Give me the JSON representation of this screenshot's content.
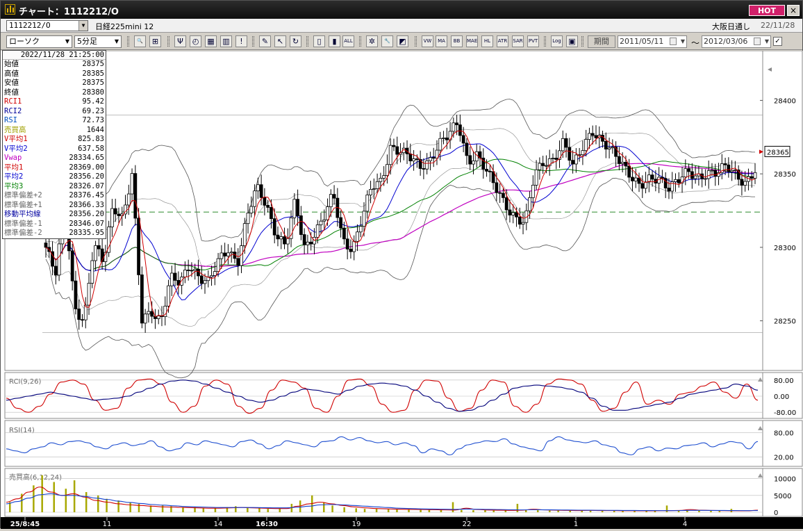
{
  "window": {
    "title": "チャート：1112212/O",
    "hot_label": "HOT",
    "close_label": "×"
  },
  "header": {
    "symbol": "1112212/O",
    "instrument": "日経225mini 12",
    "market": "大阪日通し",
    "date": "22/11/28"
  },
  "toolbar": {
    "chart_type": "ローソク",
    "interval": "5分足",
    "period_label": "期間",
    "from_date": "2011/05/11",
    "tilde": "〜",
    "to_date": "2012/03/06",
    "check_mark": "✓",
    "icons": [
      {
        "name": "zoom-icon",
        "glyph": "🔍"
      },
      {
        "name": "bar-layout-icon",
        "glyph": "⊞"
      },
      {
        "name": "bear-icon",
        "glyph": "Ψ"
      },
      {
        "name": "stopwatch-icon",
        "glyph": "◴"
      },
      {
        "name": "grid-chart-icon",
        "glyph": "▦"
      },
      {
        "name": "multi-bar-icon",
        "glyph": "▥"
      },
      {
        "name": "info-icon",
        "glyph": "!"
      },
      {
        "name": "pencil-icon",
        "glyph": "✎"
      },
      {
        "name": "cursor-icon",
        "glyph": "↖"
      },
      {
        "name": "rotate-icon",
        "glyph": "↻"
      },
      {
        "name": "candle-icon",
        "glyph": "▯"
      },
      {
        "name": "candle-split-icon",
        "glyph": "▮"
      },
      {
        "name": "all-icon",
        "glyph": "ALL"
      },
      {
        "name": "settings-icon",
        "glyph": "✲"
      },
      {
        "name": "wrench-icon",
        "glyph": "🔧"
      },
      {
        "name": "palette-icon",
        "glyph": "◩"
      },
      {
        "name": "vwap-icon",
        "glyph": "VW"
      },
      {
        "name": "ma-icon",
        "glyph": "MA"
      },
      {
        "name": "bb-icon",
        "glyph": "BB"
      },
      {
        "name": "mae-icon",
        "glyph": "MAE"
      },
      {
        "name": "hl-icon",
        "glyph": "HL"
      },
      {
        "name": "atr-icon",
        "glyph": "ATR"
      },
      {
        "name": "sar-icon",
        "glyph": "SAR"
      },
      {
        "name": "pvt-icon",
        "glyph": "PVT"
      },
      {
        "name": "log-icon",
        "glyph": "Log"
      },
      {
        "name": "window-icon",
        "glyph": "▣"
      }
    ]
  },
  "info_panel": {
    "datetime": "2022/11/28  21:25:00",
    "rows": [
      {
        "label": "始値",
        "value": "28375",
        "color": "#000000"
      },
      {
        "label": "高値",
        "value": "28385",
        "color": "#000000"
      },
      {
        "label": "安値",
        "value": "28375",
        "color": "#000000"
      },
      {
        "label": "終値",
        "value": "28380",
        "color": "#000000"
      },
      {
        "label": "RCI1",
        "value": "95.42",
        "color": "#d00000"
      },
      {
        "label": "RCI2",
        "value": "69.23",
        "color": "#000099"
      },
      {
        "label": "RSI",
        "value": "72.73",
        "color": "#0050c0"
      },
      {
        "label": "売買高",
        "value": "1644",
        "color": "#a0a000"
      },
      {
        "label": "V平均1",
        "value": "825.83",
        "color": "#d00000"
      },
      {
        "label": "V平均2",
        "value": "637.58",
        "color": "#0000d0"
      },
      {
        "label": "Vwap",
        "value": "28334.65",
        "color": "#c000c0"
      },
      {
        "label": "平均1",
        "value": "28369.00",
        "color": "#d00000"
      },
      {
        "label": "平均2",
        "value": "28356.20",
        "color": "#0000d0"
      },
      {
        "label": "平均3",
        "value": "28326.07",
        "color": "#008000"
      },
      {
        "label": "標準偏差+2",
        "value": "28376.45",
        "color": "#666666"
      },
      {
        "label": "標準偏差+1",
        "value": "28366.33",
        "color": "#666666"
      },
      {
        "label": "移動平均線",
        "value": "28356.20",
        "color": "#0000a0"
      },
      {
        "label": "標準偏差-1",
        "value": "28346.07",
        "color": "#666666"
      },
      {
        "label": "標準偏差-2",
        "value": "28335.95",
        "color": "#666666"
      }
    ]
  },
  "chart_data": [
    {
      "type": "candlestick",
      "ylim": [
        28220,
        28430
      ],
      "y_ticks": [
        28250,
        28300,
        28350,
        28400
      ],
      "current_price": "28365",
      "dashed_level": 28324,
      "x_labels": [
        "25/8:45",
        "11",
        "14",
        "16:30",
        "19",
        "22",
        "1",
        "4"
      ],
      "path": [
        28300,
        28280,
        28330,
        28260,
        28250,
        28300,
        28290,
        28330,
        28320,
        28348,
        28250,
        28258,
        28250,
        28278,
        28275,
        28290,
        28280,
        28275,
        28290,
        28300,
        28290,
        28320,
        28340,
        28330,
        28310,
        28300,
        28330,
        28300,
        28310,
        28320,
        28335,
        28305,
        28300,
        28320,
        28340,
        28345,
        28370,
        28365,
        28360,
        28355,
        28360,
        28370,
        28375,
        28385,
        28360,
        28363,
        28350,
        28340,
        28330,
        28320,
        28315,
        28350,
        28360,
        28360,
        28370,
        28355,
        28370,
        28380,
        28370,
        28365,
        28360,
        28350,
        28340,
        28345,
        28348,
        28342,
        28345,
        28350,
        28348,
        28352,
        28350,
        28354,
        28350,
        28345,
        28352
      ]
    },
    {
      "type": "line",
      "title": "RCI(9,26)",
      "ylim": [
        -100,
        100
      ],
      "y_ticks": [
        -80,
        0,
        80
      ],
      "y_tick_labels": [
        "-80.00",
        "0.00",
        "80.00"
      ],
      "series": [
        {
          "color": "#d00000",
          "values": [
            -10,
            -60,
            -80,
            -50,
            10,
            70,
            80,
            60,
            -20,
            -70,
            -60,
            40,
            80,
            85,
            60,
            -30,
            -80,
            -50,
            50,
            80,
            60,
            -50,
            -85,
            -60,
            30,
            80,
            70,
            40,
            -60,
            -80,
            0,
            80,
            85,
            50,
            -40,
            -80,
            -70,
            30,
            80,
            75,
            -10,
            -75,
            -60,
            30,
            80,
            70,
            -50,
            -80,
            -40,
            60,
            85,
            80,
            60,
            -20,
            -75,
            -60,
            20,
            70,
            -40,
            -20,
            -40,
            10,
            20,
            50,
            70,
            20,
            -10,
            60,
            -20
          ]
        },
        {
          "color": "#00007a",
          "values": [
            -20,
            -10,
            0,
            10,
            20,
            10,
            0,
            -10,
            -20,
            -15,
            -10,
            0,
            20,
            40,
            60,
            75,
            80,
            75,
            60,
            40,
            20,
            0,
            -20,
            -30,
            -20,
            0,
            20,
            35,
            30,
            20,
            10,
            30,
            50,
            60,
            65,
            60,
            50,
            30,
            0,
            -30,
            -60,
            -75,
            -70,
            -50,
            -20,
            10,
            40,
            50,
            55,
            50,
            45,
            35,
            20,
            -10,
            -50,
            -70,
            -70,
            -60,
            -50,
            -40,
            -30,
            -10,
            10,
            20,
            30,
            40,
            60,
            50,
            30
          ]
        }
      ]
    },
    {
      "type": "line",
      "title": "RSI(14)",
      "ylim": [
        0,
        100
      ],
      "y_ticks": [
        20,
        80
      ],
      "y_tick_labels": [
        "20.00",
        "80.00"
      ],
      "series": [
        {
          "color": "#2050d0",
          "values": [
            40,
            35,
            30,
            40,
            45,
            55,
            50,
            58,
            60,
            55,
            45,
            40,
            50,
            55,
            48,
            52,
            60,
            45,
            35,
            40,
            55,
            50,
            60,
            55,
            50,
            45,
            58,
            62,
            52,
            40,
            48,
            60,
            55,
            50,
            45,
            58,
            60,
            70,
            62,
            68,
            60,
            55,
            58,
            50,
            55,
            48,
            30,
            40,
            35,
            25,
            40,
            50,
            55,
            60,
            58,
            65,
            52,
            45,
            40,
            35,
            60,
            70,
            62,
            58,
            55,
            60,
            50,
            45,
            30,
            25,
            40,
            45,
            35,
            42,
            40,
            48,
            50,
            55,
            45,
            52,
            58,
            55,
            40,
            58
          ]
        }
      ]
    },
    {
      "type": "bar",
      "title": "売買高(6,12,24)",
      "ylim": [
        0,
        12000
      ],
      "y_ticks": [
        0,
        5000,
        10000
      ],
      "y_tick_labels": [
        "0",
        "5000",
        "10000"
      ],
      "volumes": [
        3000,
        5500,
        8000,
        11000,
        9000,
        7000,
        9500,
        6000,
        5000,
        4000,
        3500,
        3000,
        2500,
        2000,
        2000,
        1800,
        1500,
        1500,
        1200,
        1200,
        1500,
        1800,
        1300,
        1200,
        1000,
        1100,
        2500,
        3500,
        5000,
        3000,
        2000,
        1500,
        1200,
        1000,
        1000,
        900,
        800,
        800,
        700,
        700,
        600,
        3000,
        700,
        600,
        600,
        500,
        600,
        2500,
        700,
        600,
        500,
        500,
        600,
        500,
        500,
        400,
        500,
        400,
        500,
        500,
        600,
        2000,
        600,
        500,
        500,
        400,
        400,
        1000
      ],
      "series": [
        {
          "color": "#d00000",
          "values": [
            3000,
            4000,
            6000,
            7500,
            6000,
            5000,
            5500,
            4500,
            3500,
            3000,
            2500,
            2200,
            2000,
            1800,
            1600,
            1500,
            1400,
            1300,
            1200,
            1200,
            1300,
            1400,
            1300,
            1200,
            1100,
            1100,
            1800,
            2500,
            3000,
            2500,
            2000,
            1600,
            1300,
            1100,
            1000,
            900,
            850,
            800,
            750,
            700,
            650,
            1200,
            800,
            650,
            600,
            550,
            600,
            900,
            700,
            600,
            550,
            500,
            550,
            500,
            500,
            450,
            450,
            420,
            450,
            480,
            520,
            800,
            600,
            520,
            480,
            440,
            420,
            600
          ]
        },
        {
          "color": "#1040d0",
          "values": [
            2500,
            3200,
            4200,
            5200,
            5500,
            5000,
            5000,
            4700,
            4200,
            3800,
            3300,
            2900,
            2600,
            2300,
            2100,
            1900,
            1700,
            1600,
            1500,
            1400,
            1400,
            1400,
            1400,
            1350,
            1300,
            1300,
            1500,
            1800,
            2200,
            2300,
            2200,
            2000,
            1800,
            1600,
            1400,
            1200,
            1100,
            1000,
            950,
            900,
            850,
            950,
            900,
            850,
            800,
            750,
            700,
            750,
            720,
            690,
            650,
            620,
            600,
            580,
            560,
            540,
            520,
            500,
            490,
            480,
            490,
            560,
            560,
            540,
            520,
            500,
            480,
            500
          ]
        }
      ]
    }
  ]
}
